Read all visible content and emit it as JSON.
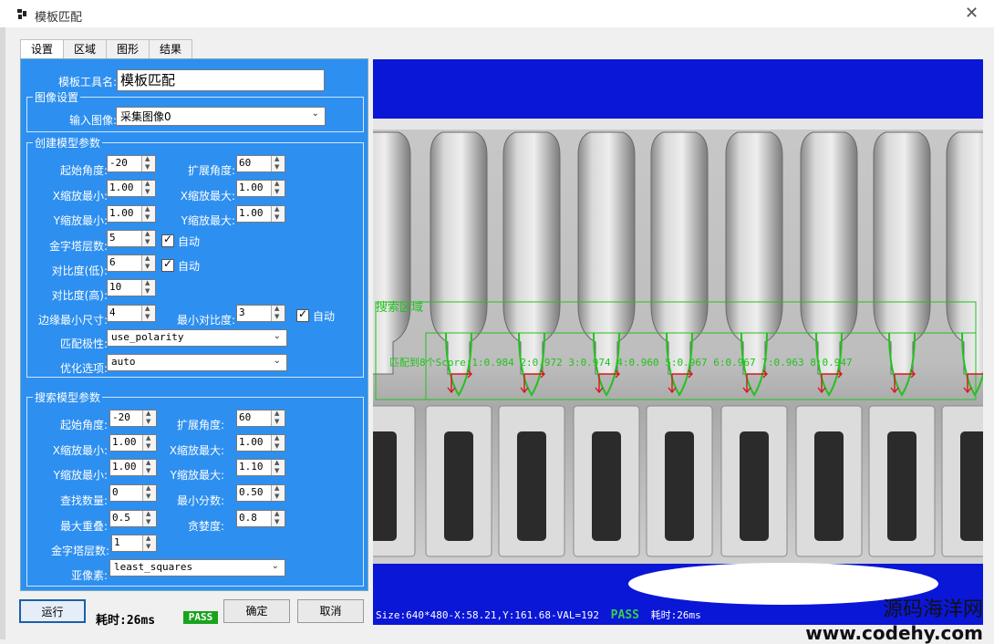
{
  "window": {
    "title": "模板匹配"
  },
  "tabs": [
    "设置",
    "区域",
    "图形",
    "结果"
  ],
  "tool_name": {
    "label": "模板工具名:",
    "value": "模板匹配"
  },
  "image_settings": {
    "title": "图像设置",
    "input_label": "输入图像:",
    "input_value": "采集图像0"
  },
  "create_model": {
    "title": "创建模型参数",
    "start_angle": {
      "label": "起始角度:",
      "value": "-20"
    },
    "angle_extent": {
      "label": "扩展角度:",
      "value": "60"
    },
    "x_scale_min": {
      "label": "X缩放最小:",
      "value": "1.00"
    },
    "x_scale_max": {
      "label": "X缩放最大:",
      "value": "1.00"
    },
    "y_scale_min": {
      "label": "Y缩放最小:",
      "value": "1.00"
    },
    "y_scale_max": {
      "label": "Y缩放最大:",
      "value": "1.00"
    },
    "pyramid_levels": {
      "label": "金字塔层数:",
      "value": "5",
      "auto_label": "自动"
    },
    "contrast_low": {
      "label": "对比度(低):",
      "value": "6",
      "auto_label": "自动"
    },
    "contrast_high": {
      "label": "对比度(高):",
      "value": "10"
    },
    "min_edge_size": {
      "label": "边缘最小尺寸:",
      "value": "4"
    },
    "min_contrast": {
      "label": "最小对比度:",
      "value": "3",
      "auto_label": "自动"
    },
    "polarity": {
      "label": "匹配极性:",
      "value": "use_polarity"
    },
    "optimization": {
      "label": "优化选项:",
      "value": "auto"
    }
  },
  "search_model": {
    "title": "搜索模型参数",
    "start_angle": {
      "label": "起始角度:",
      "value": "-20"
    },
    "angle_extent": {
      "label": "扩展角度:",
      "value": "60"
    },
    "x_scale_min": {
      "label": "X缩放最小:",
      "value": "1.00"
    },
    "x_scale_max": {
      "label": "X缩放最大:",
      "value": "1.00"
    },
    "y_scale_min": {
      "label": "Y缩放最小:",
      "value": "1.00"
    },
    "y_scale_max": {
      "label": "Y缩放最大:",
      "value": "1.10"
    },
    "num_matches": {
      "label": "查找数量:",
      "value": "0"
    },
    "min_score": {
      "label": "最小分数:",
      "value": "0.50"
    },
    "max_overlap": {
      "label": "最大重叠:",
      "value": "0.5"
    },
    "greediness": {
      "label": "贪婪度:",
      "value": "0.8"
    },
    "pyramid_levels": {
      "label": "金字塔层数:",
      "value": "1"
    },
    "subpixel": {
      "label": "亚像素:",
      "value": "least_squares"
    }
  },
  "footer": {
    "run_label": "运行",
    "time_label": "耗时:26ms",
    "pass_label": "PASS",
    "ok_label": "确定",
    "cancel_label": "取消"
  },
  "viewer": {
    "roi_label": "搜索区域",
    "match_text": "匹配到8个Score:1:0.984 2:0.972 3:0.974 4:0.960 5:0.967 6:0.967 7:0.963 8:0.947",
    "status_text": "Size:640*480-X:58.21,Y:161.68-VAL=192",
    "status_pass": "PASS",
    "status_time": "耗时:26ms"
  },
  "watermark": {
    "cn": "源码海洋网",
    "url": "www.codehy.com"
  },
  "colors": {
    "panel": "#2d8ff0",
    "viewer_bg": "#0a17d6",
    "roi": "#22c21e",
    "arrow": "#d21a1a",
    "pass": "#19a31d"
  }
}
